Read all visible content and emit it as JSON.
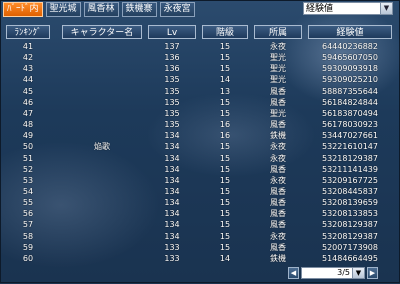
{
  "tabs": [
    "ﾊﾞｰﾄﾞ内",
    "聖光城",
    "風香林",
    "鉄機寨",
    "永夜宮"
  ],
  "sort": {
    "selected": "経験値",
    "arrow": "▼"
  },
  "columns": [
    "ﾗﾝｷﾝｸﾞ",
    "キャラクター名",
    "Lv",
    "階級",
    "所属",
    "経験値"
  ],
  "rows": [
    {
      "rank": "41",
      "name": "",
      "lv": "137",
      "grade": "15",
      "faction": "永夜",
      "exp": "64440236882"
    },
    {
      "rank": "42",
      "name": "",
      "lv": "136",
      "grade": "15",
      "faction": "聖光",
      "exp": "59465607050"
    },
    {
      "rank": "43",
      "name": "",
      "lv": "136",
      "grade": "15",
      "faction": "聖光",
      "exp": "59309093918"
    },
    {
      "rank": "44",
      "name": "",
      "lv": "135",
      "grade": "14",
      "faction": "聖光",
      "exp": "59309025210"
    },
    {
      "rank": "45",
      "name": "",
      "lv": "135",
      "grade": "13",
      "faction": "風香",
      "exp": "58887355644"
    },
    {
      "rank": "46",
      "name": "",
      "lv": "135",
      "grade": "15",
      "faction": "風香",
      "exp": "56184824844"
    },
    {
      "rank": "47",
      "name": "",
      "lv": "135",
      "grade": "15",
      "faction": "聖光",
      "exp": "56183870494"
    },
    {
      "rank": "48",
      "name": "",
      "lv": "135",
      "grade": "16",
      "faction": "風香",
      "exp": "56178030923"
    },
    {
      "rank": "49",
      "name": "",
      "lv": "134",
      "grade": "16",
      "faction": "鉄機",
      "exp": "53447027661"
    },
    {
      "rank": "50",
      "name": "焔歌",
      "lv": "134",
      "grade": "15",
      "faction": "永夜",
      "exp": "53221610147"
    },
    {
      "rank": "51",
      "name": "",
      "lv": "134",
      "grade": "15",
      "faction": "永夜",
      "exp": "53218129387"
    },
    {
      "rank": "52",
      "name": "",
      "lv": "134",
      "grade": "15",
      "faction": "風香",
      "exp": "53211141439"
    },
    {
      "rank": "53",
      "name": "",
      "lv": "134",
      "grade": "15",
      "faction": "永夜",
      "exp": "53209167725"
    },
    {
      "rank": "54",
      "name": "",
      "lv": "134",
      "grade": "15",
      "faction": "風香",
      "exp": "53208445837"
    },
    {
      "rank": "55",
      "name": "",
      "lv": "134",
      "grade": "15",
      "faction": "風香",
      "exp": "53208139659"
    },
    {
      "rank": "56",
      "name": "",
      "lv": "134",
      "grade": "15",
      "faction": "風香",
      "exp": "53208133853"
    },
    {
      "rank": "57",
      "name": "",
      "lv": "134",
      "grade": "15",
      "faction": "風香",
      "exp": "53208129387"
    },
    {
      "rank": "58",
      "name": "",
      "lv": "134",
      "grade": "15",
      "faction": "永夜",
      "exp": "53208129387"
    },
    {
      "rank": "59",
      "name": "",
      "lv": "133",
      "grade": "15",
      "faction": "風香",
      "exp": "52007173908"
    },
    {
      "rank": "60",
      "name": "",
      "lv": "133",
      "grade": "14",
      "faction": "鉄機",
      "exp": "51484664495"
    }
  ],
  "pager": {
    "label": "3/5",
    "prev": "◀",
    "next": "▶",
    "down": "▼"
  }
}
